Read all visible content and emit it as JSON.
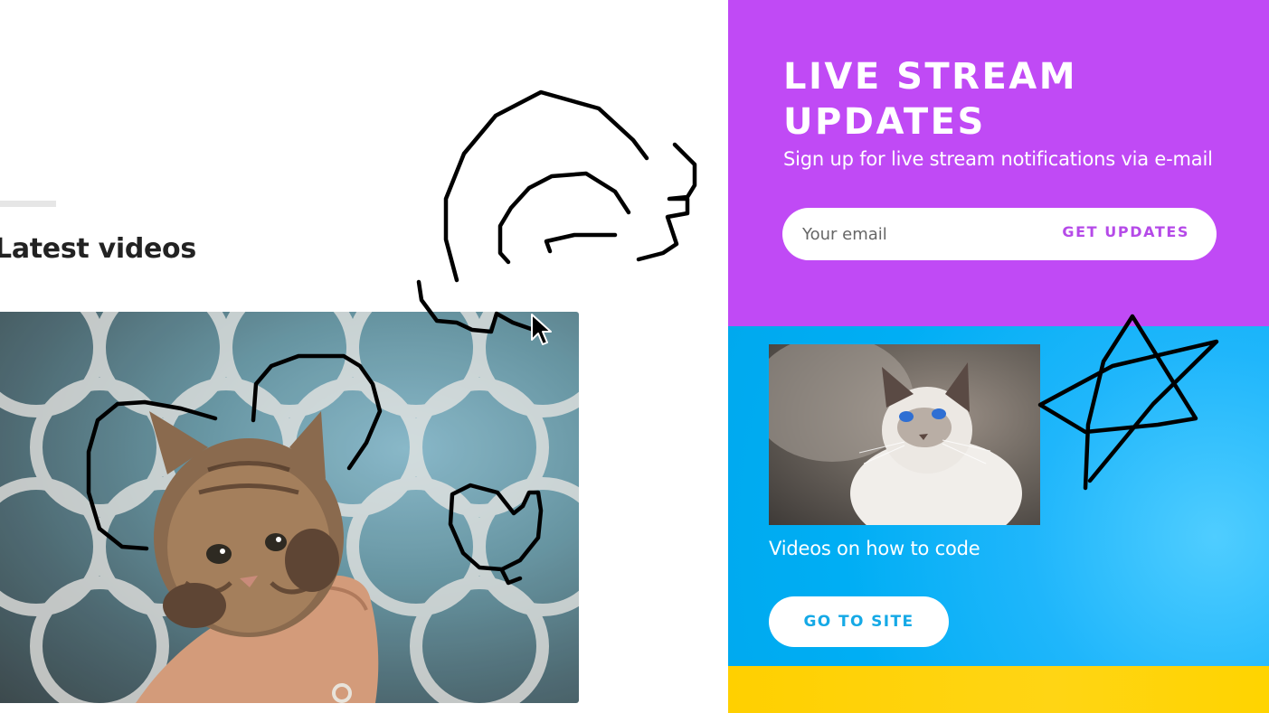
{
  "latest": {
    "heading": "Latest videos",
    "video_image": "kitten-held-in-hand-photo"
  },
  "live_stream": {
    "title_line_1": "LIVE STREAM",
    "title_line_2": "UPDATES",
    "subtitle": "Sign up for live stream notifications via e-mail",
    "email_placeholder": "Your email",
    "email_value": "",
    "submit_label": "GET UPDATES",
    "background_color": "#c04af5"
  },
  "coding": {
    "image": "white-cat-looking-up-photo",
    "caption": "Videos on how to code",
    "button_label": "GO TO SITE",
    "background_color": "#00aef4"
  },
  "footer_strip": {
    "background_color": "#ffd400"
  },
  "annotations": {
    "ink_color": "#000000",
    "shapes": [
      "spiral-scribble",
      "arc-scribble",
      "heart-scribble",
      "star-scribble"
    ],
    "cursor": "arrow-cursor-icon"
  }
}
